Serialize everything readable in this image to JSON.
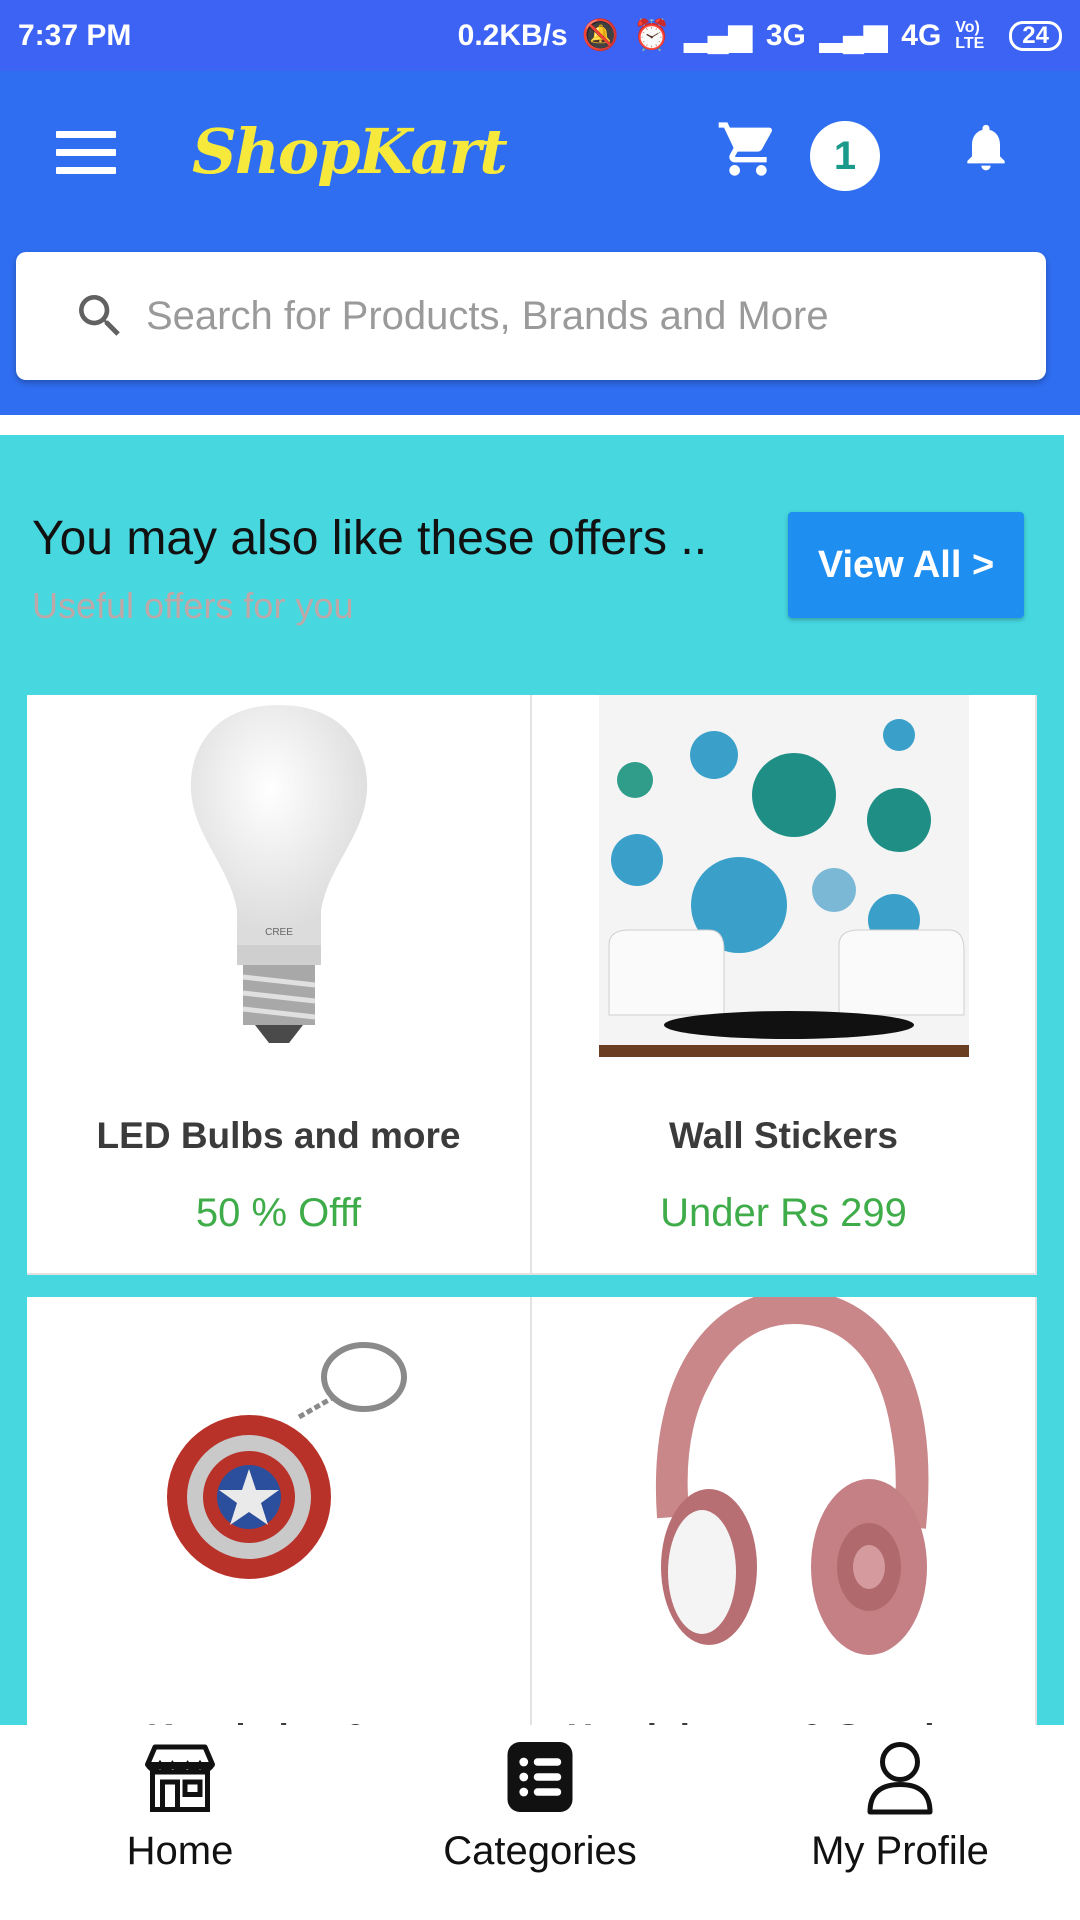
{
  "status_bar": {
    "time": "7:37 PM",
    "net_speed": "0.2KB/s",
    "network1": "3G",
    "network2": "4G",
    "volte": "Vo) LTE",
    "battery": "24"
  },
  "app_bar": {
    "logo": "ShopKart",
    "cart_count": "1",
    "brand_color": "#2f6ef0",
    "logo_color": "#f7e93b"
  },
  "search": {
    "placeholder": "Search for Products, Brands and More",
    "value": ""
  },
  "offers": {
    "title": "You may also like these offers ..",
    "subtitle": "Useful offers for you",
    "view_all_label": "View All >",
    "background": "#46d7df",
    "items": [
      {
        "name": "LED Bulbs and more",
        "offer": "50 % Offf",
        "image": "led-bulb"
      },
      {
        "name": "Wall Stickers",
        "offer": "Under Rs 299",
        "image": "wall-stickers"
      },
      {
        "name": "Keychains & ...",
        "offer": "",
        "image": "captain-america-keychain"
      },
      {
        "name": "Headphones & Speakers",
        "offer": "",
        "image": "pink-headphones"
      }
    ]
  },
  "bottom_nav": {
    "items": [
      {
        "label": "Home",
        "icon": "store-icon"
      },
      {
        "label": "Categories",
        "icon": "list-icon"
      },
      {
        "label": "My Profile",
        "icon": "user-icon"
      }
    ]
  }
}
